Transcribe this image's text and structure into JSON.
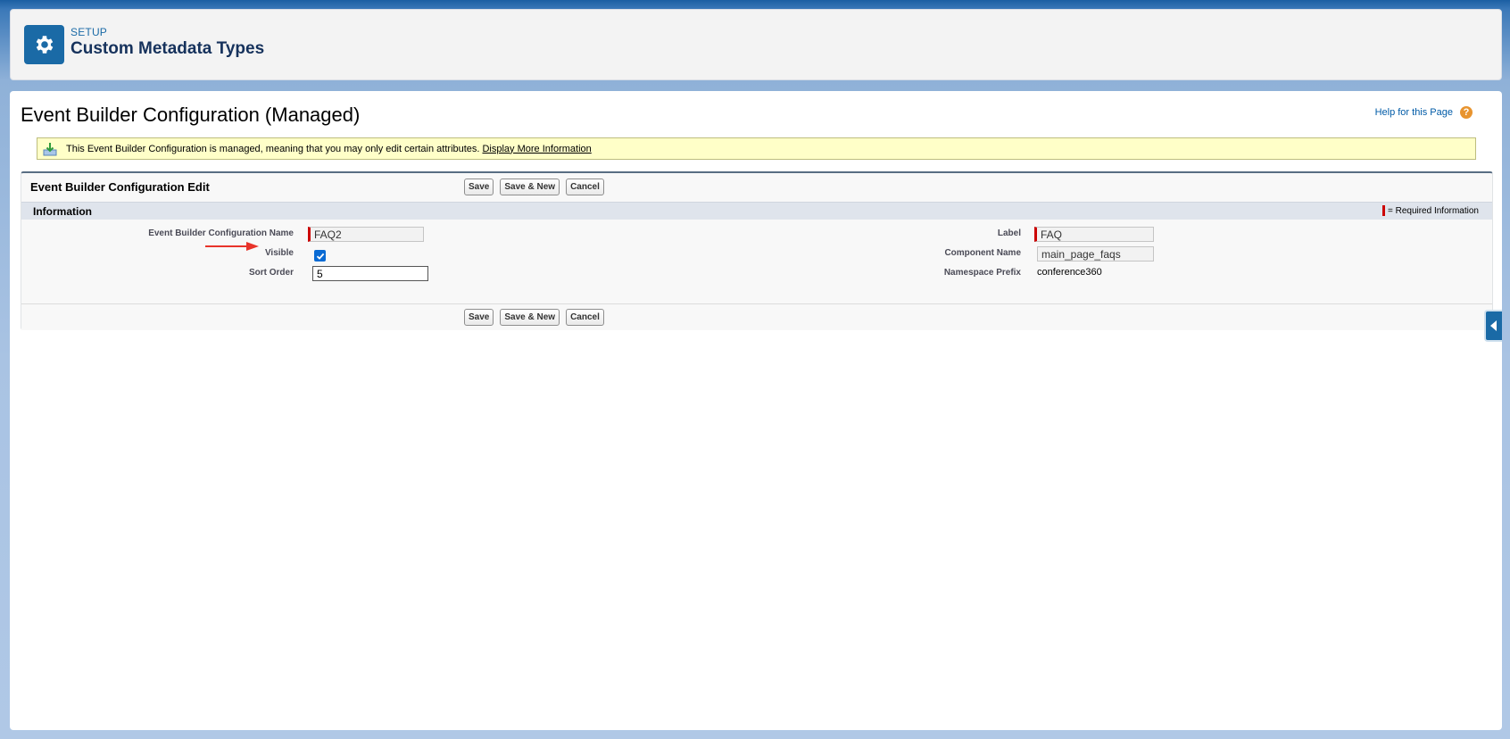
{
  "setup_header": {
    "eyebrow": "SETUP",
    "title": "Custom Metadata Types",
    "icon": "gear-icon"
  },
  "page": {
    "title": "Event Builder Configuration (Managed)",
    "help_link": "Help for this Page",
    "help_icon": "?"
  },
  "banner": {
    "text": "This Event Builder Configuration is managed, meaning that you may only edit certain attributes.",
    "link": "Display More Information"
  },
  "edit_block": {
    "title": "Event Builder Configuration Edit",
    "buttons": {
      "save": "Save",
      "save_new": "Save & New",
      "cancel": "Cancel"
    },
    "section_title": "Information",
    "required_info": "= Required Information",
    "fields": {
      "config_name": {
        "label": "Event Builder Configuration Name",
        "value": "FAQ2"
      },
      "visible": {
        "label": "Visible",
        "checked": true
      },
      "sort_order": {
        "label": "Sort Order",
        "value": "5"
      },
      "label": {
        "label": "Label",
        "value": "FAQ"
      },
      "component_name": {
        "label": "Component Name",
        "value": "main_page_faqs"
      },
      "namespace_prefix": {
        "label": "Namespace Prefix",
        "value": "conference360"
      }
    }
  },
  "colors": {
    "brand_blue": "#1a6aa6",
    "required_red": "#cc0000",
    "annotation_arrow": "#e8332a"
  }
}
